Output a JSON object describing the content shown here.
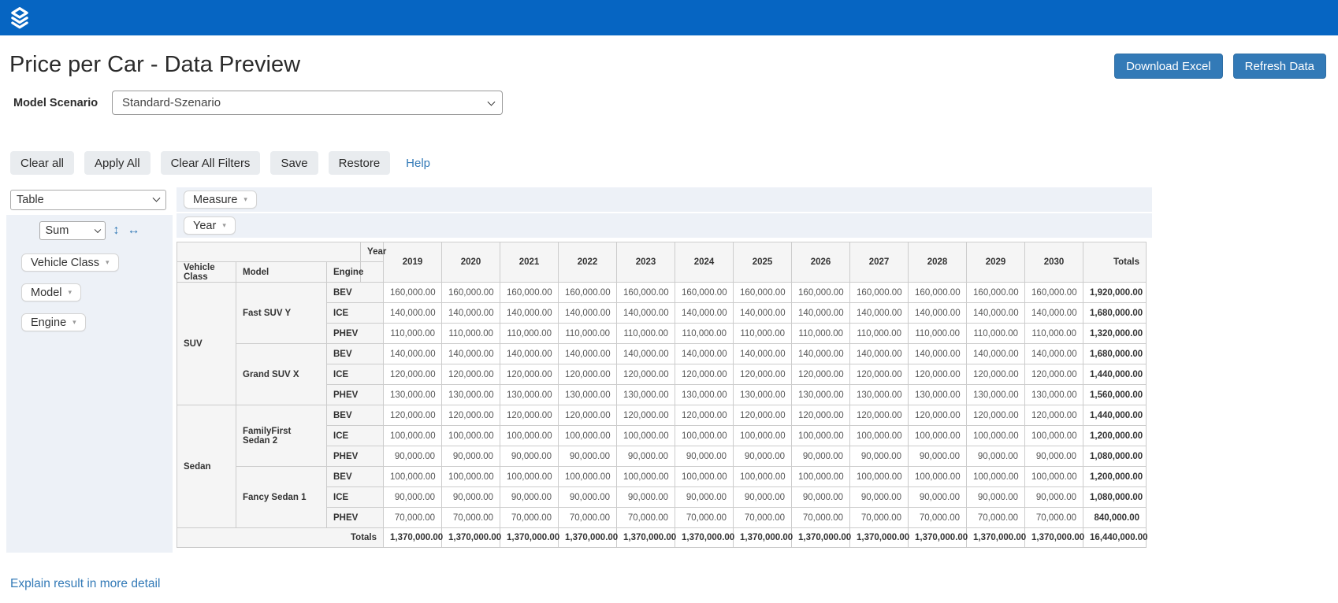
{
  "header": {
    "title": "Price per Car - Data Preview",
    "download_button": "Download Excel",
    "refresh_button": "Refresh Data"
  },
  "scenario": {
    "label": "Model Scenario",
    "selected_option": "Standard-Szenario"
  },
  "actions": {
    "clear_all": "Clear all",
    "apply_all": "Apply All",
    "clear_all_filters": "Clear All Filters",
    "save": "Save",
    "restore": "Restore",
    "help": "Help"
  },
  "pivot": {
    "renderer_selected": "Table",
    "aggregator_selected": "Sum",
    "measure_pill": "Measure",
    "year_pill": "Year",
    "field_pills": [
      "Vehicle Class",
      "Model",
      "Engine"
    ],
    "table": {
      "corner_label": "Year",
      "row_headers": [
        "Vehicle Class",
        "Model",
        "Engine"
      ],
      "year_columns": [
        "2019",
        "2020",
        "2021",
        "2022",
        "2023",
        "2024",
        "2025",
        "2026",
        "2027",
        "2028",
        "2029",
        "2030"
      ],
      "totals_header": "Totals",
      "rows": [
        {
          "vehicle_class": "SUV",
          "model": "Fast SUV Y",
          "engine": "BEV",
          "year_value": "160,000.00",
          "row_total": "1,920,000.00"
        },
        {
          "engine": "ICE",
          "year_value": "140,000.00",
          "row_total": "1,680,000.00"
        },
        {
          "engine": "PHEV",
          "year_value": "110,000.00",
          "row_total": "1,320,000.00"
        },
        {
          "model": "Grand SUV X",
          "engine": "BEV",
          "year_value": "140,000.00",
          "row_total": "1,680,000.00"
        },
        {
          "engine": "ICE",
          "year_value": "120,000.00",
          "row_total": "1,440,000.00"
        },
        {
          "engine": "PHEV",
          "year_value": "130,000.00",
          "row_total": "1,560,000.00"
        },
        {
          "vehicle_class": "Sedan",
          "model": "FamilyFirst Sedan 2",
          "engine": "BEV",
          "year_value": "120,000.00",
          "row_total": "1,440,000.00"
        },
        {
          "engine": "ICE",
          "year_value": "100,000.00",
          "row_total": "1,200,000.00"
        },
        {
          "engine": "PHEV",
          "year_value": "90,000.00",
          "row_total": "1,080,000.00"
        },
        {
          "model": "Fancy Sedan 1",
          "engine": "BEV",
          "year_value": "100,000.00",
          "row_total": "1,200,000.00"
        },
        {
          "engine": "ICE",
          "year_value": "90,000.00",
          "row_total": "1,080,000.00"
        },
        {
          "engine": "PHEV",
          "year_value": "70,000.00",
          "row_total": "840,000.00"
        }
      ],
      "totals_row": {
        "label": "Totals",
        "year_value": "1,370,000.00",
        "grand_total": "16,440,000.00"
      }
    }
  },
  "footer": {
    "explain_link": "Explain result in more detail"
  },
  "colors": {
    "topbar": "#0665c2",
    "primary_button": "#337ab7",
    "panel_bg": "#edf1f7",
    "header_cell_bg": "#f5f5f5",
    "table_border": "#cccccc",
    "link": "#337ab7"
  }
}
